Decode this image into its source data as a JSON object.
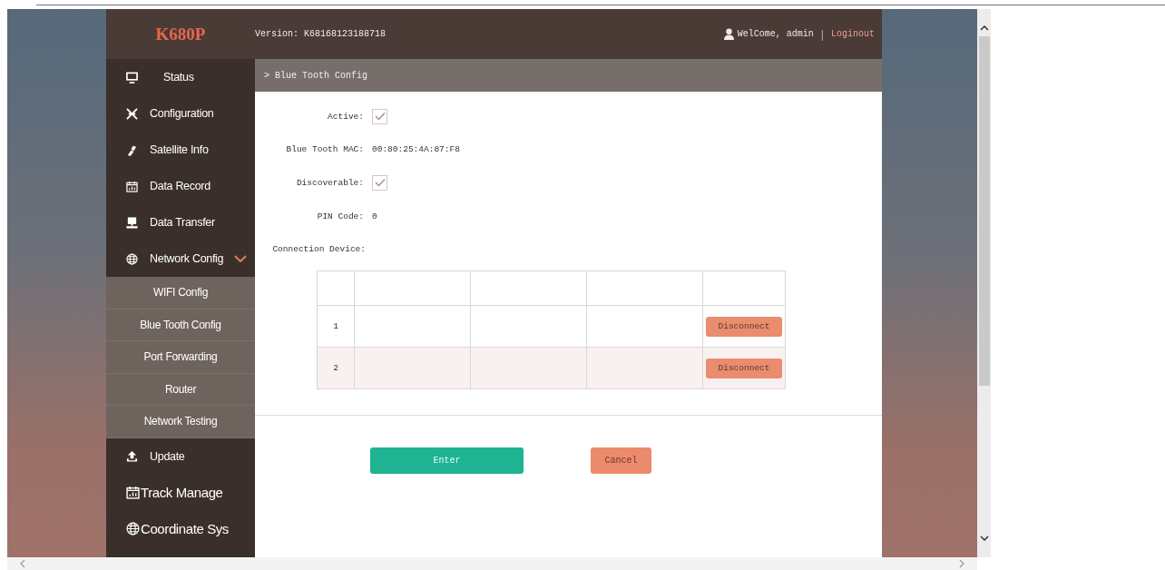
{
  "header": {
    "logo": "K680P",
    "version": "Version: K68168123188718",
    "welcome": "WelCome, admin",
    "separator": "|",
    "logout": "Loginout"
  },
  "sidebar": {
    "items": [
      {
        "label": "Status",
        "kind": "standard"
      },
      {
        "label": "Configuration",
        "kind": "standard"
      },
      {
        "label": "Satellite Info",
        "kind": "standard"
      },
      {
        "label": "Data Record",
        "kind": "standard"
      },
      {
        "label": "Data Transfer",
        "kind": "standard"
      },
      {
        "label": "Network Config",
        "kind": "standard",
        "expanded": true,
        "children": [
          {
            "label": "WIFI Config"
          },
          {
            "label": "Blue Tooth Config"
          },
          {
            "label": "Port Forwarding"
          },
          {
            "label": "Router"
          },
          {
            "label": "Network Testing"
          }
        ]
      },
      {
        "label": "Update",
        "kind": "standard"
      },
      {
        "label": "Track Manage",
        "kind": "large"
      },
      {
        "label": "Coordinate Sys",
        "kind": "large"
      }
    ]
  },
  "breadcrumb": "> Blue Tooth Config",
  "form": {
    "fields": [
      {
        "label": "Active:",
        "kind": "checkbox",
        "checked": true
      },
      {
        "label": "Blue Tooth MAC:",
        "kind": "text",
        "value": "00:80:25:4A:87:F8"
      },
      {
        "label": "Discoverable:",
        "kind": "checkbox",
        "checked": true
      },
      {
        "label": "PIN Code:",
        "kind": "text",
        "value": "0"
      },
      {
        "label": "Connection Device:",
        "kind": "heading"
      }
    ]
  },
  "table": {
    "rows": [
      {
        "index": "1",
        "action": "Disconnect"
      },
      {
        "index": "2",
        "action": "Disconnect"
      }
    ]
  },
  "buttons": {
    "enter": "Enter",
    "cancel": "Cancel"
  }
}
